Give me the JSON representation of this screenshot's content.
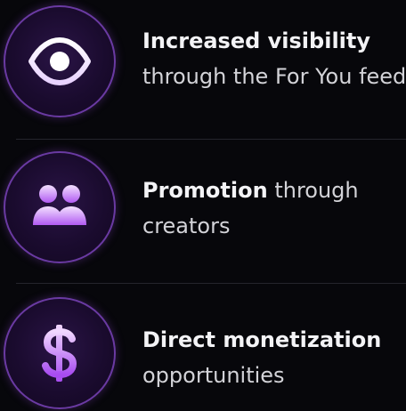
{
  "features": [
    {
      "icon": "eye-icon",
      "title_bold": "Increased visibility",
      "title_rest": "",
      "line2": "through the For You feed"
    },
    {
      "icon": "users-icon",
      "title_bold": "Promotion",
      "title_rest": " through",
      "line2": "creators"
    },
    {
      "icon": "dollar-icon",
      "title_bold": "Direct monetization",
      "title_rest": "",
      "line2": "opportunities"
    }
  ],
  "colors": {
    "background": "#07070b",
    "icon_gradient_top": "#f1d9ff",
    "icon_gradient_bottom": "#a64cf0",
    "circle_ring": "#6a3aa2",
    "text": "#e6e6ea"
  }
}
